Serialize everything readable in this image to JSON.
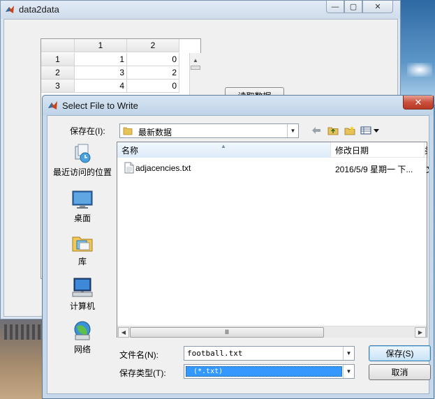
{
  "bg_window": {
    "title": "data2data",
    "controls": {
      "minimize": "—",
      "maximize": "▢",
      "close": "✕"
    },
    "table": {
      "col_headers": [
        "1",
        "2"
      ],
      "rows": [
        {
          "row": "1",
          "values": [
            "1",
            "0"
          ]
        },
        {
          "row": "2",
          "values": [
            "3",
            "2"
          ]
        },
        {
          "row": "3",
          "values": [
            "4",
            "0"
          ]
        }
      ]
    },
    "read_button_label": "读取数据"
  },
  "dialog": {
    "title": "Select File to Write",
    "close_label": "✕",
    "save_in_label": "保存在(I):",
    "save_in_value": "最新数据",
    "toolbar_icons": [
      "back-arrow-icon",
      "up-folder-icon",
      "new-folder-icon",
      "view-menu-icon"
    ],
    "places": [
      {
        "label": "最近访问的位置",
        "icon": "recent-places-icon"
      },
      {
        "label": "桌面",
        "icon": "desktop-icon"
      },
      {
        "label": "库",
        "icon": "libraries-icon"
      },
      {
        "label": "计算机",
        "icon": "computer-icon"
      },
      {
        "label": "网络",
        "icon": "network-icon"
      }
    ],
    "columns": {
      "name": "名称",
      "date": "修改日期",
      "more": "类"
    },
    "files": [
      {
        "name": "adjacencies.txt",
        "date": "2016/5/9 星期一 下...",
        "type_cut": "文"
      }
    ],
    "scroll_thumb_grip": "Ⅲ",
    "file_name_label": "文件名(N):",
    "file_name_value": "football.txt",
    "file_type_label": "保存类型(T):",
    "file_type_value": "(*.txt)",
    "save_button_label": "保存(S)",
    "cancel_button_label": "取消"
  },
  "colors": {
    "selection": "#3399ff",
    "close_button": "#c9503d",
    "dialog_frame": "#c6d8ea"
  }
}
